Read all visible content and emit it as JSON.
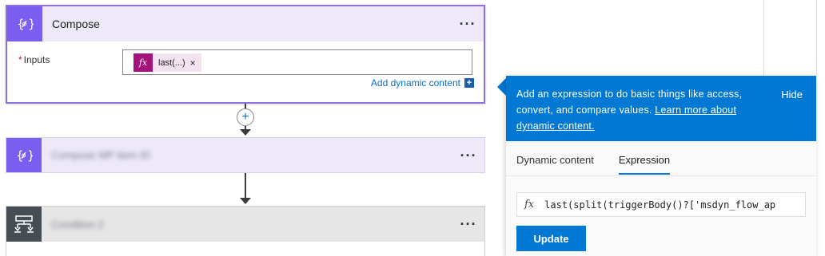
{
  "compose": {
    "title": "Compose",
    "more": "···",
    "inputs_label": "Inputs",
    "required_mark": "*",
    "token_label": "last(...)",
    "token_remove": "×",
    "add_dynamic": "Add dynamic content",
    "add_dynamic_plus": "+"
  },
  "add_step": "+",
  "compose2": {
    "title": "Compose MP Item ID",
    "more": "···"
  },
  "condition": {
    "title": "Condition 2",
    "more": "···"
  },
  "panel": {
    "message_part1": "Add an expression to do basic things like access, convert, and compare values. ",
    "message_link": "Learn more about dynamic content.",
    "hide": "Hide",
    "tabs": [
      {
        "label": "Dynamic content",
        "active": false
      },
      {
        "label": "Expression",
        "active": true
      }
    ],
    "fx_symbol": "fx",
    "expression": "last(split(triggerBody()?['msdyn_flow_ap",
    "update": "Update"
  },
  "colors": {
    "accent": "#0078d4",
    "compose_icon": "#7a5ef0",
    "token_icon": "#a4127c",
    "condition_icon": "#474d55"
  },
  "icons": [
    "compose-curly-icon",
    "fx-icon",
    "condition-icon",
    "plus-icon"
  ]
}
